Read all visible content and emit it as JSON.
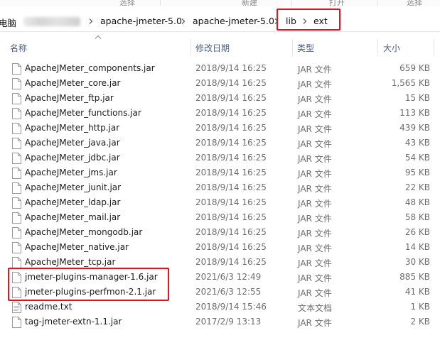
{
  "ribbon": {
    "labels": [
      "选择",
      "新建",
      "打开",
      "选择"
    ]
  },
  "address_bar": {
    "crumbs": [
      "电脑",
      "apache-jmeter-5.0",
      "apache-jmeter-5.0",
      "lib",
      "ext"
    ]
  },
  "columns": {
    "name": "名称",
    "date": "修改日期",
    "type": "类型",
    "size": "大小"
  },
  "files": [
    {
      "name": "ApacheJMeter_components.jar",
      "date": "2018/9/14 16:25",
      "type": "JAR 文件",
      "size": "659 KB",
      "icon": "file-icon"
    },
    {
      "name": "ApacheJMeter_core.jar",
      "date": "2018/9/14 16:25",
      "type": "JAR 文件",
      "size": "1,565 KB",
      "icon": "file-icon"
    },
    {
      "name": "ApacheJMeter_ftp.jar",
      "date": "2018/9/14 16:25",
      "type": "JAR 文件",
      "size": "15 KB",
      "icon": "file-icon"
    },
    {
      "name": "ApacheJMeter_functions.jar",
      "date": "2018/9/14 16:25",
      "type": "JAR 文件",
      "size": "113 KB",
      "icon": "file-icon"
    },
    {
      "name": "ApacheJMeter_http.jar",
      "date": "2018/9/14 16:25",
      "type": "JAR 文件",
      "size": "439 KB",
      "icon": "file-icon"
    },
    {
      "name": "ApacheJMeter_java.jar",
      "date": "2018/9/14 16:25",
      "type": "JAR 文件",
      "size": "43 KB",
      "icon": "file-icon"
    },
    {
      "name": "ApacheJMeter_jdbc.jar",
      "date": "2018/9/14 16:25",
      "type": "JAR 文件",
      "size": "54 KB",
      "icon": "file-icon"
    },
    {
      "name": "ApacheJMeter_jms.jar",
      "date": "2018/9/14 16:25",
      "type": "JAR 文件",
      "size": "95 KB",
      "icon": "file-icon"
    },
    {
      "name": "ApacheJMeter_junit.jar",
      "date": "2018/9/14 16:25",
      "type": "JAR 文件",
      "size": "22 KB",
      "icon": "file-icon"
    },
    {
      "name": "ApacheJMeter_ldap.jar",
      "date": "2018/9/14 16:25",
      "type": "JAR 文件",
      "size": "48 KB",
      "icon": "file-icon"
    },
    {
      "name": "ApacheJMeter_mail.jar",
      "date": "2018/9/14 16:25",
      "type": "JAR 文件",
      "size": "58 KB",
      "icon": "file-icon"
    },
    {
      "name": "ApacheJMeter_mongodb.jar",
      "date": "2018/9/14 16:25",
      "type": "JAR 文件",
      "size": "26 KB",
      "icon": "file-icon"
    },
    {
      "name": "ApacheJMeter_native.jar",
      "date": "2018/9/14 16:25",
      "type": "JAR 文件",
      "size": "14 KB",
      "icon": "file-icon"
    },
    {
      "name": "ApacheJMeter_tcp.jar",
      "date": "2018/9/14 16:25",
      "type": "JAR 文件",
      "size": "30 KB",
      "icon": "file-icon"
    },
    {
      "name": "jmeter-plugins-manager-1.6.jar",
      "date": "2021/6/3 12:49",
      "type": "JAR 文件",
      "size": "885 KB",
      "icon": "file-icon"
    },
    {
      "name": "jmeter-plugins-perfmon-2.1.jar",
      "date": "2021/6/3 12:55",
      "type": "JAR 文件",
      "size": "41 KB",
      "icon": "file-icon"
    },
    {
      "name": "readme.txt",
      "date": "2018/9/14 15:46",
      "type": "文本文档",
      "size": "1 KB",
      "icon": "text-file-icon"
    },
    {
      "name": "tag-jmeter-extn-1.1.jar",
      "date": "2017/2/9 13:13",
      "type": "JAR 文件",
      "size": "2 KB",
      "icon": "file-icon"
    }
  ],
  "highlight_color": "#e0141e"
}
